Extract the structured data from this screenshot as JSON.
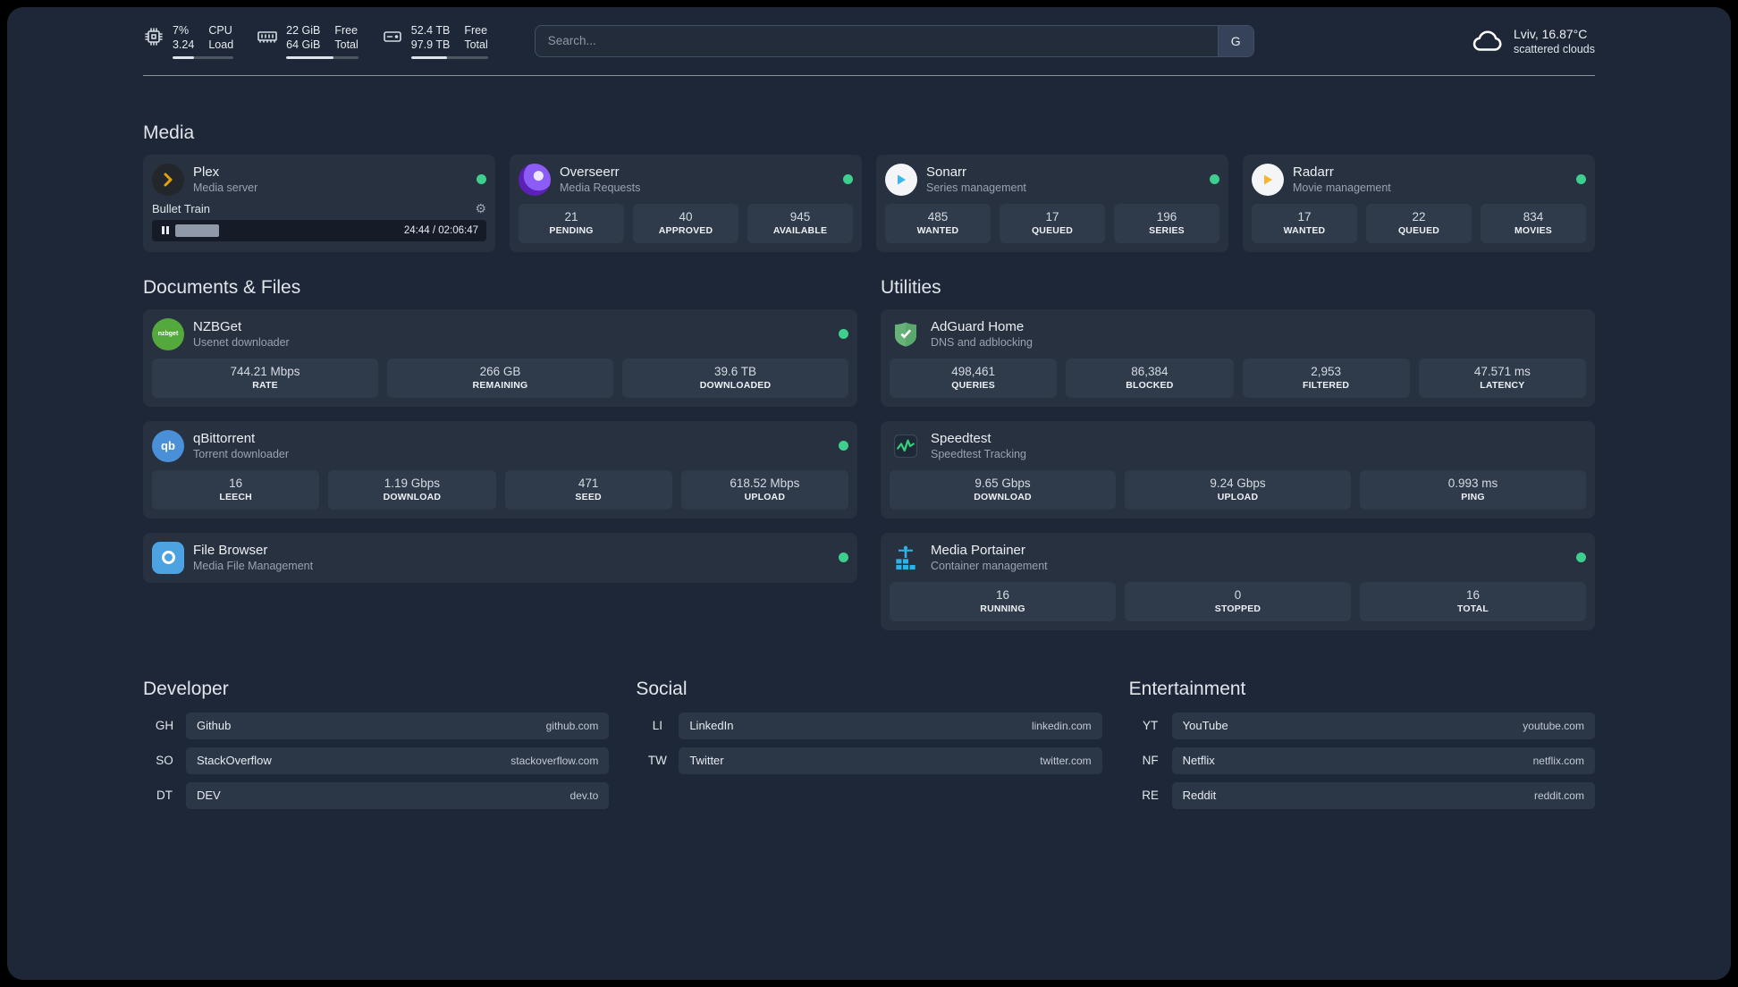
{
  "header": {
    "cpu": {
      "value1": "7%",
      "value2": "3.24",
      "label1": "CPU",
      "label2": "Load",
      "bar_percent": 35
    },
    "memory": {
      "value1": "22 GiB",
      "value2": "64 GiB",
      "label1": "Free",
      "label2": "Total",
      "bar_percent": 66
    },
    "disk": {
      "value1": "52.4 TB",
      "value2": "97.9 TB",
      "label1": "Free",
      "label2": "Total",
      "bar_percent": 47
    },
    "search": {
      "placeholder": "Search...",
      "provider_label": "G"
    },
    "weather": {
      "location": "Lviv, 16.87°C",
      "condition": "scattered clouds"
    }
  },
  "sections": {
    "media": {
      "title": "Media",
      "plex": {
        "name": "Plex",
        "description": "Media server",
        "now_playing": {
          "title": "Bullet Train",
          "time": "24:44 / 02:06:47",
          "progress_percent": 19.5
        }
      },
      "overseerr": {
        "name": "Overseerr",
        "description": "Media Requests",
        "stats": [
          {
            "value": "21",
            "label": "PENDING"
          },
          {
            "value": "40",
            "label": "APPROVED"
          },
          {
            "value": "945",
            "label": "AVAILABLE"
          }
        ]
      },
      "sonarr": {
        "name": "Sonarr",
        "description": "Series management",
        "stats": [
          {
            "value": "485",
            "label": "WANTED"
          },
          {
            "value": "17",
            "label": "QUEUED"
          },
          {
            "value": "196",
            "label": "SERIES"
          }
        ]
      },
      "radarr": {
        "name": "Radarr",
        "description": "Movie management",
        "stats": [
          {
            "value": "17",
            "label": "WANTED"
          },
          {
            "value": "22",
            "label": "QUEUED"
          },
          {
            "value": "834",
            "label": "MOVIES"
          }
        ]
      }
    },
    "documents": {
      "title": "Documents & Files",
      "nzbget": {
        "name": "NZBGet",
        "description": "Usenet downloader",
        "icon_text": "nzbget",
        "stats": [
          {
            "value": "744.21 Mbps",
            "label": "RATE"
          },
          {
            "value": "266 GB",
            "label": "REMAINING"
          },
          {
            "value": "39.6 TB",
            "label": "DOWNLOADED"
          }
        ]
      },
      "qbittorrent": {
        "name": "qBittorrent",
        "description": "Torrent downloader",
        "icon_text": "qb",
        "stats": [
          {
            "value": "16",
            "label": "LEECH"
          },
          {
            "value": "1.19 Gbps",
            "label": "DOWNLOAD"
          },
          {
            "value": "471",
            "label": "SEED"
          },
          {
            "value": "618.52 Mbps",
            "label": "UPLOAD"
          }
        ]
      },
      "filebrowser": {
        "name": "File Browser",
        "description": "Media File Management"
      }
    },
    "utilities": {
      "title": "Utilities",
      "adguard": {
        "name": "AdGuard Home",
        "description": "DNS and adblocking",
        "stats": [
          {
            "value": "498,461",
            "label": "QUERIES"
          },
          {
            "value": "86,384",
            "label": "BLOCKED"
          },
          {
            "value": "2,953",
            "label": "FILTERED"
          },
          {
            "value": "47.571 ms",
            "label": "LATENCY"
          }
        ]
      },
      "speedtest": {
        "name": "Speedtest",
        "description": "Speedtest Tracking",
        "stats": [
          {
            "value": "9.65 Gbps",
            "label": "DOWNLOAD"
          },
          {
            "value": "9.24 Gbps",
            "label": "UPLOAD"
          },
          {
            "value": "0.993 ms",
            "label": "PING"
          }
        ]
      },
      "portainer": {
        "name": "Media Portainer",
        "description": "Container management",
        "stats": [
          {
            "value": "16",
            "label": "RUNNING"
          },
          {
            "value": "0",
            "label": "STOPPED"
          },
          {
            "value": "16",
            "label": "TOTAL"
          }
        ]
      }
    }
  },
  "bookmarks": {
    "developer": {
      "title": "Developer",
      "items": [
        {
          "abbr": "GH",
          "name": "Github",
          "url": "github.com"
        },
        {
          "abbr": "SO",
          "name": "StackOverflow",
          "url": "stackoverflow.com"
        },
        {
          "abbr": "DT",
          "name": "DEV",
          "url": "dev.to"
        }
      ]
    },
    "social": {
      "title": "Social",
      "items": [
        {
          "abbr": "LI",
          "name": "LinkedIn",
          "url": "linkedin.com"
        },
        {
          "abbr": "TW",
          "name": "Twitter",
          "url": "twitter.com"
        }
      ]
    },
    "entertainment": {
      "title": "Entertainment",
      "items": [
        {
          "abbr": "YT",
          "name": "YouTube",
          "url": "youtube.com"
        },
        {
          "abbr": "NF",
          "name": "Netflix",
          "url": "netflix.com"
        },
        {
          "abbr": "RE",
          "name": "Reddit",
          "url": "reddit.com"
        }
      ]
    }
  },
  "colors": {
    "status_online": "#3ecf8e",
    "accent_plex": "#e5a00d",
    "background": "#1d2737"
  }
}
